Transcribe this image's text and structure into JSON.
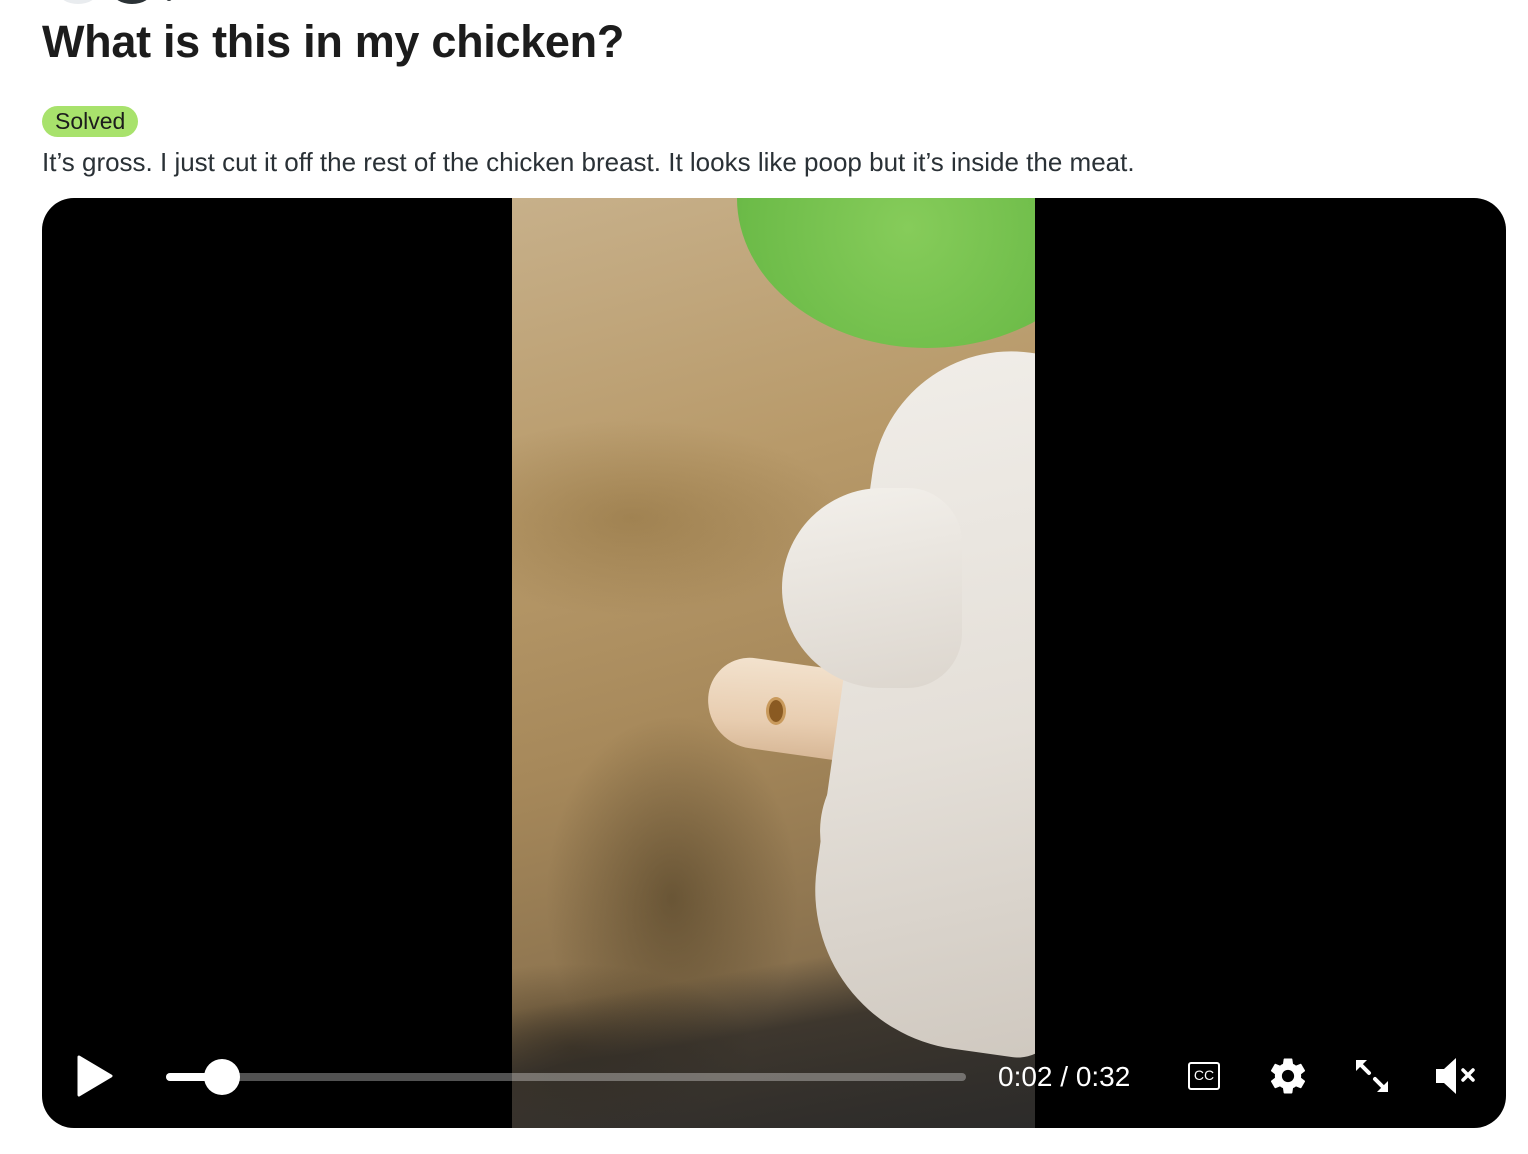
{
  "post": {
    "title": "What is this in my chicken?",
    "flair": "Solved",
    "body": "It’s gross. I just cut it off the rest of the chicken breast. It looks like poop but it’s inside the meat."
  },
  "video": {
    "current_time": "0:02",
    "duration": "0:32",
    "time_display": "0:02 / 0:32",
    "progress_fraction": 0.07,
    "cc_label": "CC",
    "muted": true
  },
  "colors": {
    "flair_bg": "#a8e26c",
    "title_text": "#1c1c1c",
    "body_text": "#2a3136",
    "player_bg": "#000000"
  },
  "icons": {
    "play": "play-icon",
    "cc": "closed-captions-icon",
    "settings": "gear-icon",
    "fullscreen": "expand-icon",
    "volume": "volume-muted-icon"
  }
}
